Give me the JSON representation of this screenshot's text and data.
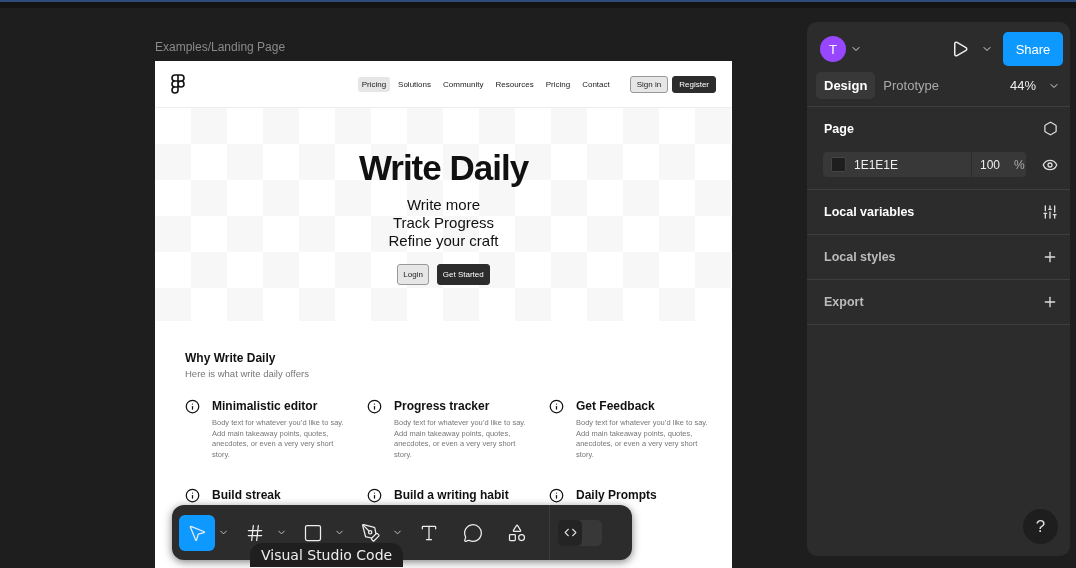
{
  "canvas": {
    "frame_label": "Examples/Landing Page",
    "nav_links": [
      {
        "label": "Pricing",
        "selected": true
      },
      {
        "label": "Solutions",
        "selected": false
      },
      {
        "label": "Community",
        "selected": false
      },
      {
        "label": "Resources",
        "selected": false
      },
      {
        "label": "Pricing",
        "selected": false
      },
      {
        "label": "Contact",
        "selected": false
      }
    ],
    "nav_buttons": [
      {
        "label": "Sign in",
        "kind": "outline"
      },
      {
        "label": "Register",
        "kind": "filled"
      }
    ],
    "hero": {
      "title": "Write Daily",
      "taglines": [
        "Write more",
        "Track Progress",
        "Refine your craft"
      ],
      "buttons": [
        {
          "label": "Login",
          "kind": "outline"
        },
        {
          "label": "Get Started",
          "kind": "filled"
        }
      ]
    },
    "features": {
      "title": "Why Write Daily",
      "subtitle": "Here is what write daily offers",
      "items": [
        {
          "title": "Minimalistic editor",
          "body": "Body text for whatever you’d like to say. Add main takeaway points, quotes, anecdotes, or even a very very short story."
        },
        {
          "title": "Progress tracker",
          "body": "Body text for whatever you’d like to say. Add main takeaway points, quotes, anecdotes, or even a very very short story."
        },
        {
          "title": "Get Feedback",
          "body": "Body text for whatever you’d like to say. Add main takeaway points, quotes, anecdotes, or even a very very short story."
        },
        {
          "title": "Build streak"
        },
        {
          "title": "Build a writing habit"
        },
        {
          "title": "Daily Prompts"
        }
      ]
    }
  },
  "toolbar": {
    "tools": [
      {
        "kind": "move",
        "selected": true
      },
      {
        "kind": "frame",
        "selected": false
      },
      {
        "kind": "shape",
        "selected": false
      },
      {
        "kind": "pen",
        "selected": false
      },
      {
        "kind": "text",
        "selected": false
      },
      {
        "kind": "comment",
        "selected": false
      },
      {
        "kind": "actions",
        "selected": false
      }
    ],
    "dev_mode": false,
    "tooltip": "Visual Studio Code"
  },
  "panel": {
    "avatar_initial": "T",
    "share": "Share",
    "tabs": [
      {
        "label": "Design",
        "selected": true
      },
      {
        "label": "Prototype",
        "selected": false
      }
    ],
    "zoom": "44%",
    "page": {
      "title": "Page",
      "color": "1E1E1E",
      "opacity": "100",
      "unit": "%"
    },
    "sections": [
      {
        "label": "Local variables",
        "kind": "variables",
        "emphasized": true
      },
      {
        "label": "Local styles",
        "kind": "add",
        "emphasized": false
      },
      {
        "label": "Export",
        "kind": "add",
        "emphasized": false
      }
    ],
    "help": "?"
  }
}
